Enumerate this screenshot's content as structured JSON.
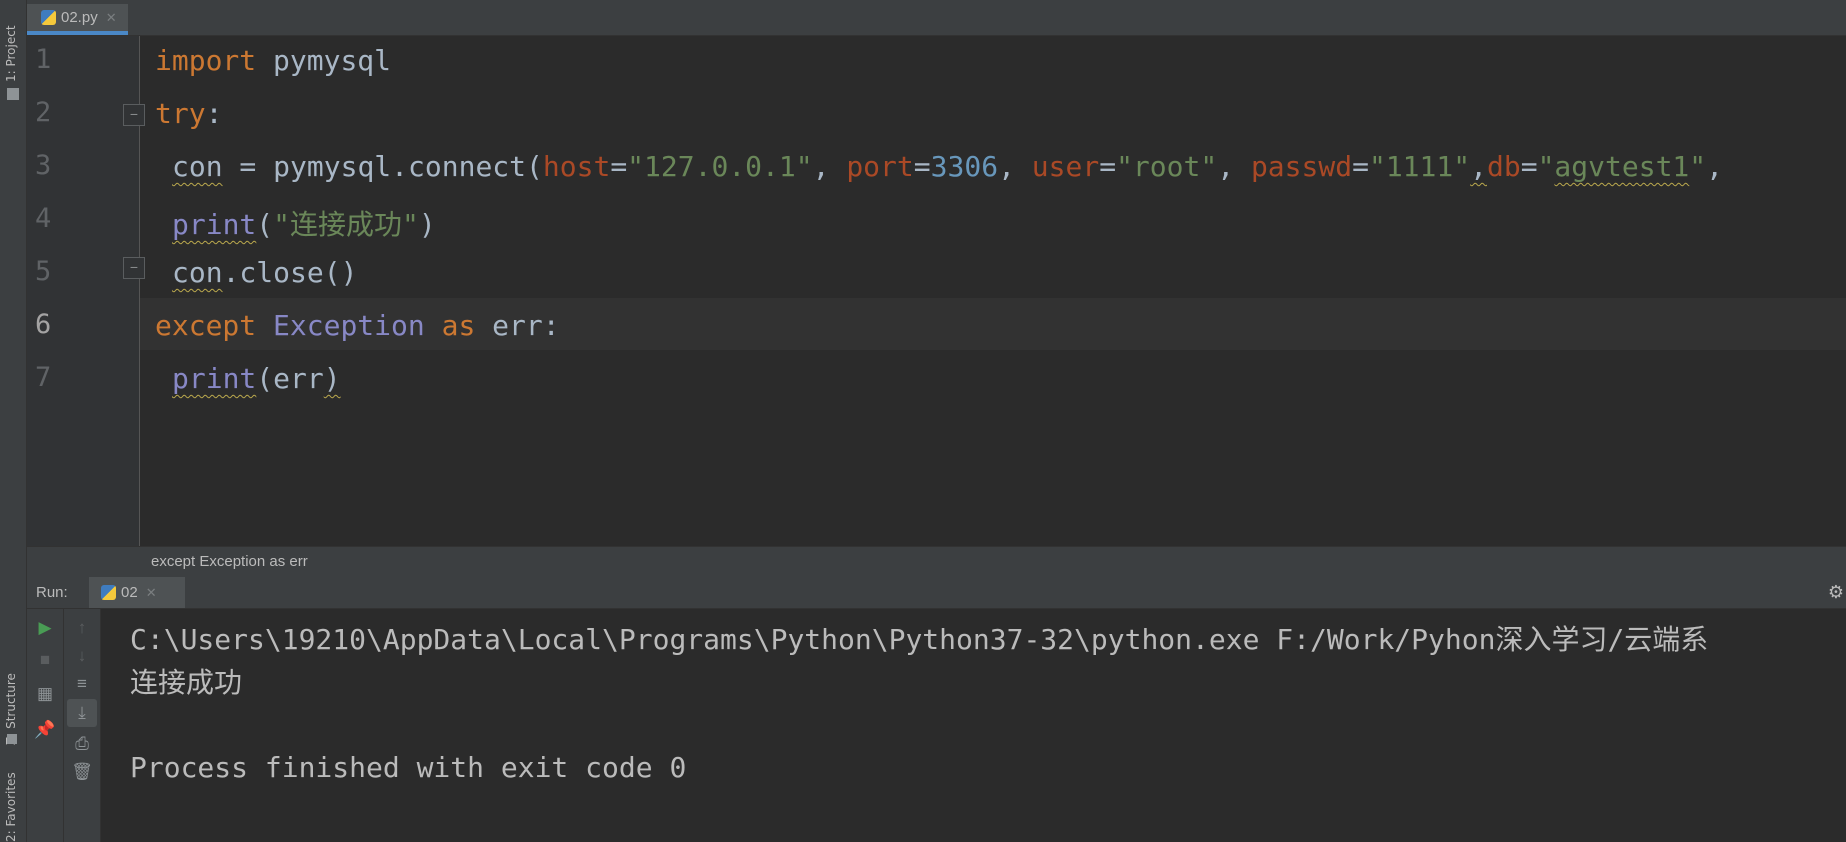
{
  "sidebar": {
    "project_label": "1: Project",
    "structure_label": "Z: Structure",
    "favorites_label": "2: Favorites"
  },
  "editor_tab": {
    "filename": "02.py"
  },
  "code_lines": [
    {
      "number": "1",
      "text": "import pymysql"
    },
    {
      "number": "2",
      "text": "try:"
    },
    {
      "number": "3",
      "text": "con = pymysql.connect(host=\"127.0.0.1\", port=3306, user=\"root\", passwd=\"1111\",db=\"agvtest1\","
    },
    {
      "number": "4",
      "text": "print(\"连接成功\")"
    },
    {
      "number": "5",
      "text": "con.close()"
    },
    {
      "number": "6",
      "text": "except Exception as err:"
    },
    {
      "number": "7",
      "text": "print(err)"
    }
  ],
  "current_line": 6,
  "breadcrumb": "except Exception as err",
  "run_panel": {
    "label": "Run:",
    "tab_label": "02"
  },
  "console": {
    "lines": [
      "C:\\Users\\19210\\AppData\\Local\\Programs\\Python\\Python37-32\\python.exe F:/Work/Pyhon深入学习/云端系",
      "连接成功",
      "",
      "Process finished with exit code 0"
    ]
  },
  "colors": {
    "background": "#2b2b2b",
    "keyword": "#cc7832",
    "string": "#6a8759",
    "number": "#6897bb",
    "param": "#aa4926",
    "builtin": "#8888c6"
  }
}
